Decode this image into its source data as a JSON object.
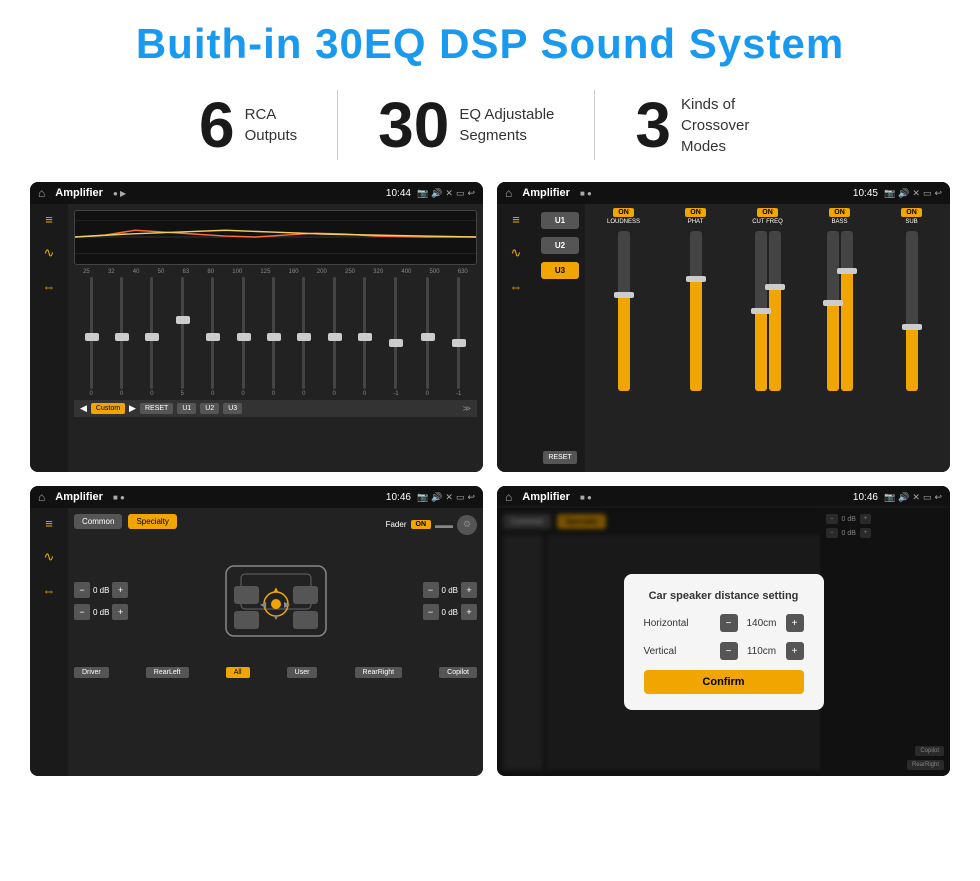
{
  "page": {
    "title": "Buith-in 30EQ DSP Sound System",
    "stats": [
      {
        "number": "6",
        "desc_line1": "RCA",
        "desc_line2": "Outputs"
      },
      {
        "number": "30",
        "desc_line1": "EQ Adjustable",
        "desc_line2": "Segments"
      },
      {
        "number": "3",
        "desc_line1": "Kinds of",
        "desc_line2": "Crossover Modes"
      }
    ]
  },
  "screens": {
    "screen1": {
      "app": "Amplifier",
      "time": "10:44",
      "freq_labels": [
        "25",
        "32",
        "40",
        "50",
        "63",
        "80",
        "100",
        "125",
        "160",
        "200",
        "250",
        "320",
        "400",
        "500",
        "630"
      ],
      "eq_values": [
        "0",
        "0",
        "0",
        "5",
        "0",
        "0",
        "0",
        "0",
        "0",
        "0",
        "-1",
        "0",
        "-1"
      ],
      "buttons": [
        "Custom",
        "RESET",
        "U1",
        "U2",
        "U3"
      ]
    },
    "screen2": {
      "app": "Amplifier",
      "time": "10:45",
      "presets": [
        "U1",
        "U2",
        "U3"
      ],
      "channels": [
        "LOUDNESS",
        "PHAT",
        "CUT FREQ",
        "BASS",
        "SUB"
      ],
      "reset_label": "RESET"
    },
    "screen3": {
      "app": "Amplifier",
      "time": "10:46",
      "tabs": [
        "Common",
        "Specialty"
      ],
      "fader_label": "Fader",
      "toggle_label": "ON",
      "volumes": [
        "0 dB",
        "0 dB",
        "0 dB",
        "0 dB"
      ],
      "bottom_buttons": [
        "Driver",
        "RearLeft",
        "All",
        "User",
        "RearRight",
        "Copilot"
      ]
    },
    "screen4": {
      "app": "Amplifier",
      "time": "10:46",
      "dialog": {
        "title": "Car speaker distance setting",
        "horizontal_label": "Horizontal",
        "horizontal_value": "140cm",
        "vertical_label": "Vertical",
        "vertical_value": "110cm",
        "confirm_label": "Confirm"
      }
    }
  }
}
